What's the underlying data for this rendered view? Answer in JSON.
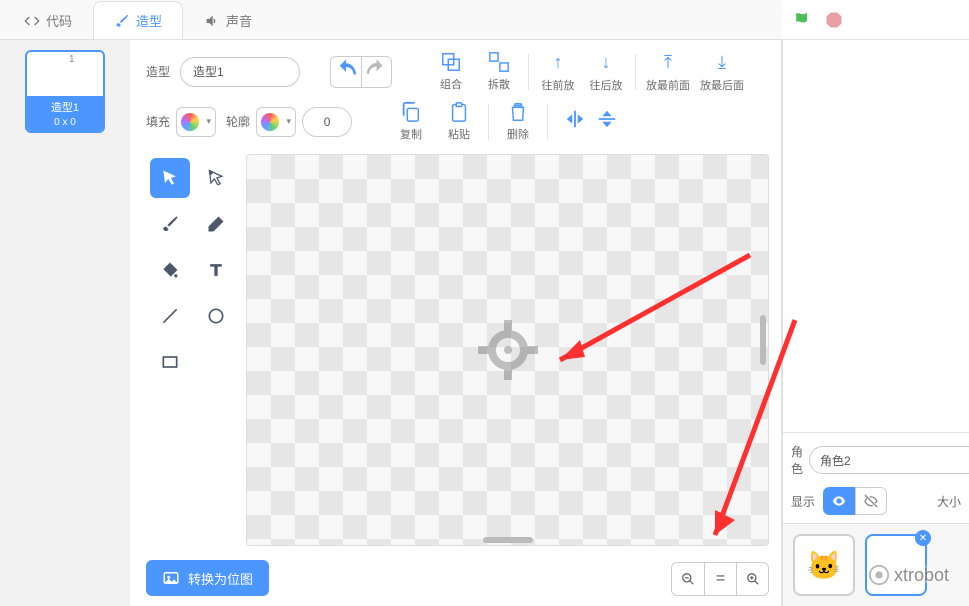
{
  "tabs": {
    "code": "代码",
    "costume": "造型",
    "sound": "声音"
  },
  "costume_list": {
    "items": [
      {
        "index": "1",
        "name": "造型1",
        "dim": "0 x 0"
      }
    ]
  },
  "editor": {
    "costume_label": "造型",
    "costume_name": "造型1",
    "toolbar_top": {
      "group": "组合",
      "ungroup": "拆散",
      "forward": "往前放",
      "backward": "往后放",
      "front": "放最前面",
      "back": "放最后面"
    },
    "fill_label": "填充",
    "outline_label": "轮廓",
    "outline_width": "0",
    "toolbar2": {
      "copy": "复制",
      "paste": "粘贴",
      "delete": "删除"
    },
    "convert_bitmap": "转换为位图"
  },
  "sprite_panel": {
    "sprite_label": "角色",
    "sprite_name": "角色2",
    "visible_label": "显示",
    "size_label": "大小"
  },
  "watermark": "xtrobot",
  "icons": {
    "flag": "green-flag-icon",
    "stop": "stop-icon",
    "code": "code-icon",
    "costume": "brush-icon",
    "sound": "sound-icon",
    "undo": "undo-icon",
    "redo": "redo-icon",
    "group": "group-icon",
    "ungroup": "ungroup-icon",
    "forward": "forward-icon",
    "backward": "backward-icon",
    "front": "front-icon",
    "back": "back-icon",
    "copy": "copy-icon",
    "paste": "paste-icon",
    "delete": "trash-icon",
    "fliph": "flip-horizontal-icon",
    "flipv": "flip-vertical-icon",
    "select": "pointer-icon",
    "reshape": "reshape-icon",
    "brush": "paintbrush-icon",
    "eraser": "eraser-icon",
    "fill": "bucket-icon",
    "text": "text-icon",
    "line": "line-icon",
    "circle": "circle-icon",
    "rect": "rectangle-icon",
    "bitmap": "image-icon",
    "zoom_out": "zoom-out-icon",
    "zoom_reset": "zoom-reset-icon",
    "zoom_in": "zoom-in-icon",
    "eye": "eye-open-icon",
    "eye_off": "eye-closed-icon"
  }
}
